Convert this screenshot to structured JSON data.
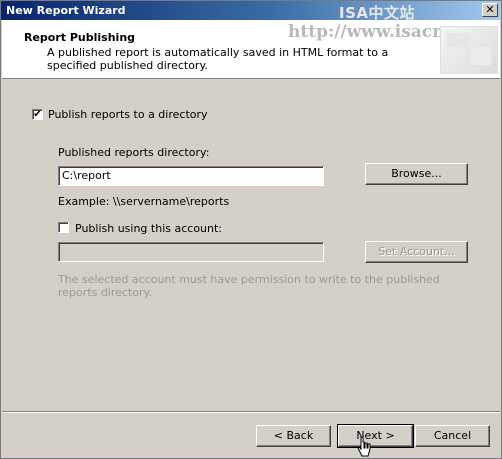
{
  "window": {
    "title": "New Report Wizard",
    "watermark_title": "ISA中文站"
  },
  "header": {
    "heading": "Report Publishing",
    "description": "A published report is automatically saved in HTML format to a specified published directory.",
    "watermark_url": "http://www.isacn.org"
  },
  "publish": {
    "checkbox_label": "Publish reports to a directory",
    "checked": true,
    "dir_label": "Published reports directory:",
    "dir_value": "C:\\report",
    "browse_label": "Browse...",
    "example": "Example: \\\\servername\\reports"
  },
  "account": {
    "checkbox_label": "Publish using this account:",
    "checked": false,
    "account_value": "",
    "set_account_label": "Set Account...",
    "note": "The selected account must have permission to write to the published reports directory."
  },
  "footer": {
    "back_label": "< Back",
    "next_label": "Next >",
    "cancel_label": "Cancel"
  }
}
